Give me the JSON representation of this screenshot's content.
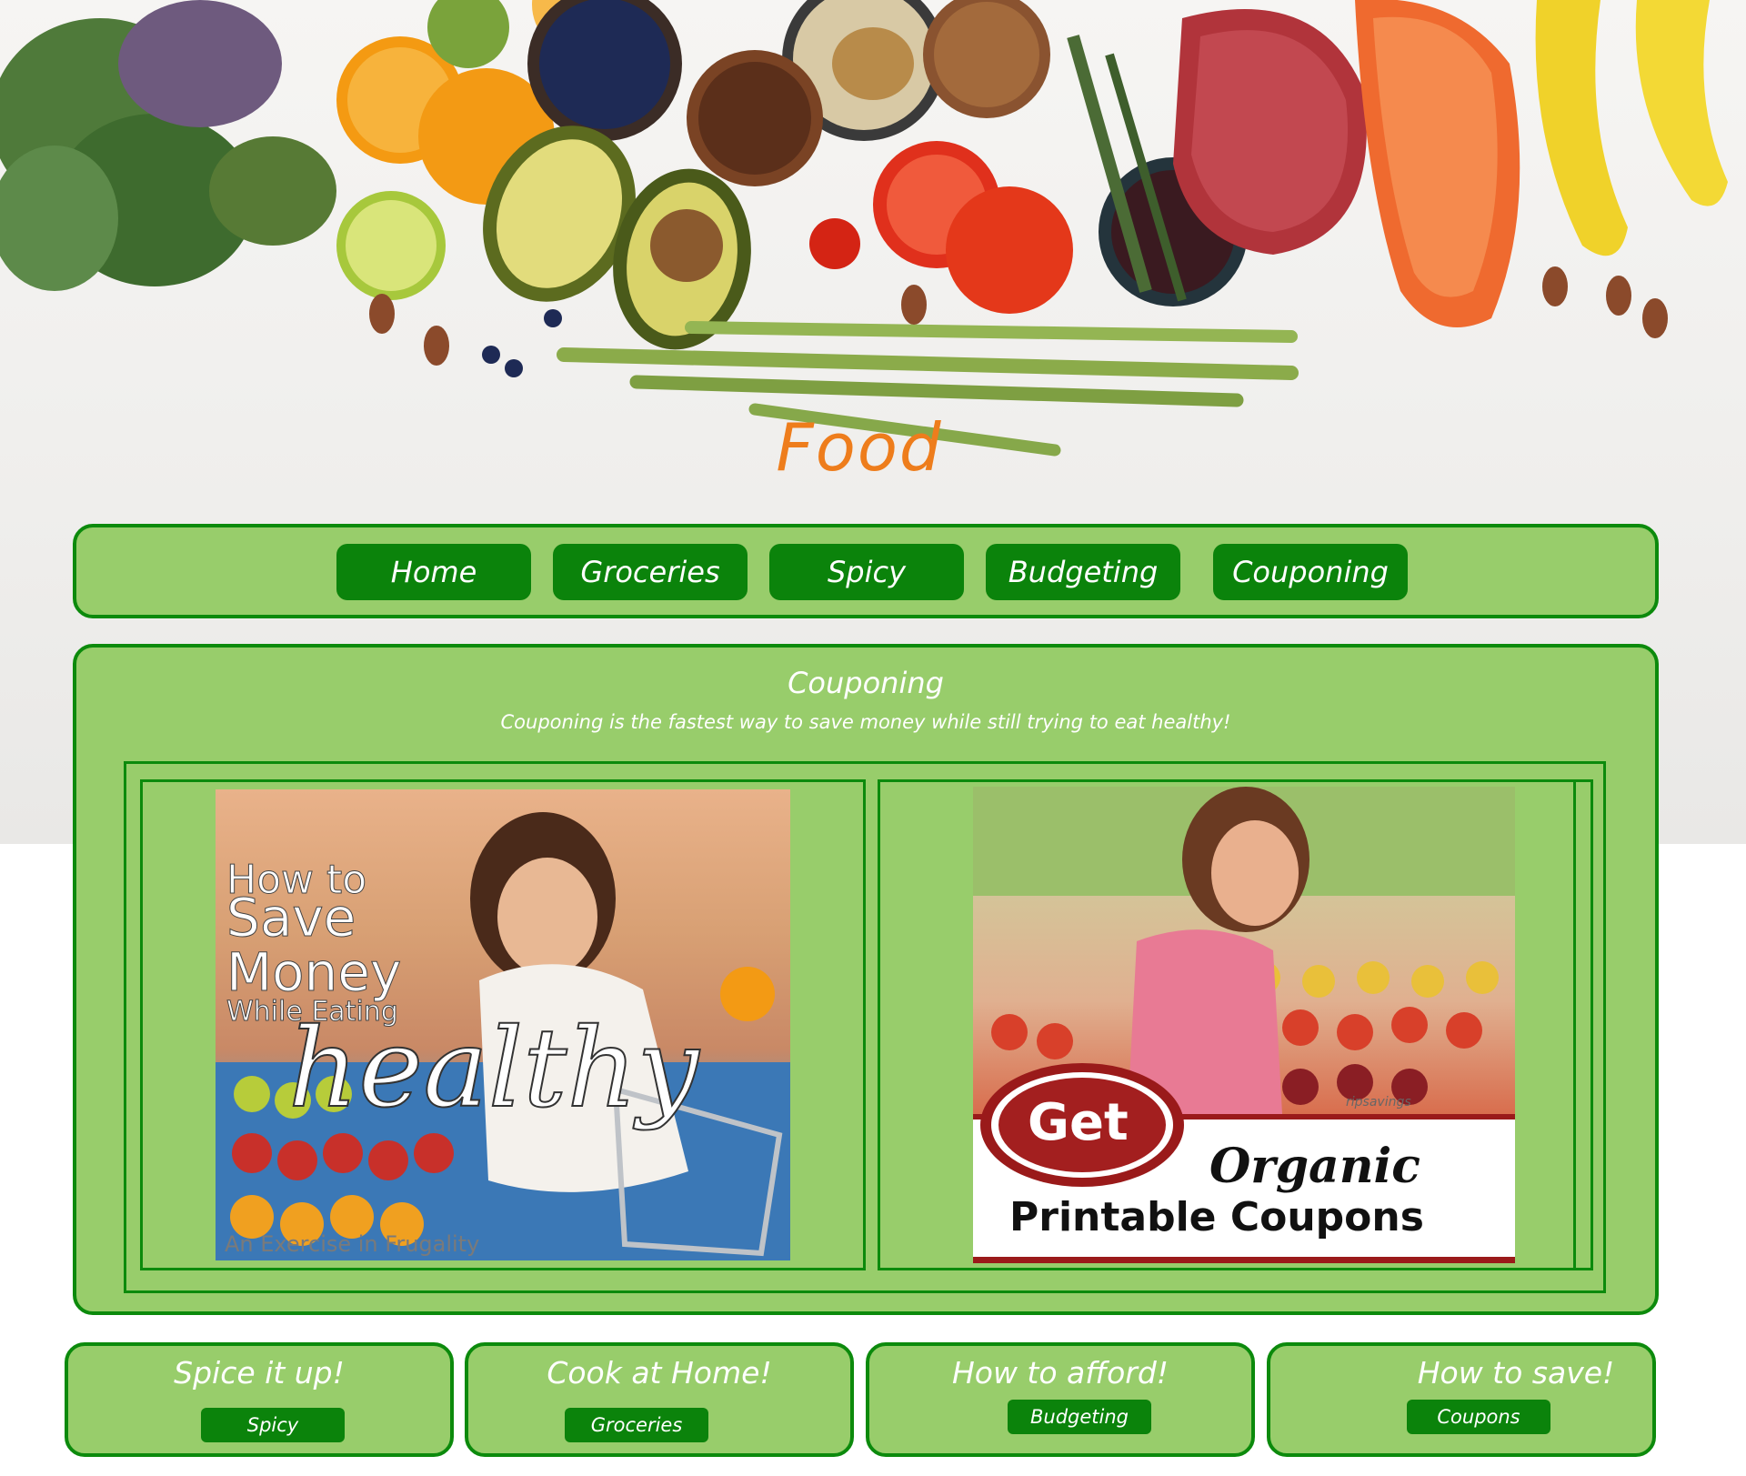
{
  "header": {
    "title": "Food"
  },
  "nav": {
    "items": [
      "Home",
      "Groceries",
      "Spicy",
      "Budgeting",
      "Couponing"
    ]
  },
  "main": {
    "heading": "Couponing",
    "subtitle": "Couponing is the fastest way to save money while still trying to eat healthy!",
    "left_image": {
      "line1": "How to",
      "line2": "Save",
      "line3": "Money",
      "line4": "While Eating",
      "line5": "healthy",
      "line6": "An Exercise in Frugality"
    },
    "right_image": {
      "badge": "Get",
      "line1": "Organic",
      "line2": "Printable Coupons",
      "watermark": "ripsavings"
    }
  },
  "footer": [
    {
      "title": "Spice it up!",
      "button": "Spicy"
    },
    {
      "title": "Cook at Home!",
      "button": "Groceries"
    },
    {
      "title": "How to afford!",
      "button": "Budgeting"
    },
    {
      "title": "How to save!",
      "button": "Coupons"
    }
  ],
  "colors": {
    "panel_bg": "#98cd6b",
    "panel_border": "#0c8a0c",
    "button_bg": "#0b830b",
    "title_orange": "#ee7d1c"
  }
}
